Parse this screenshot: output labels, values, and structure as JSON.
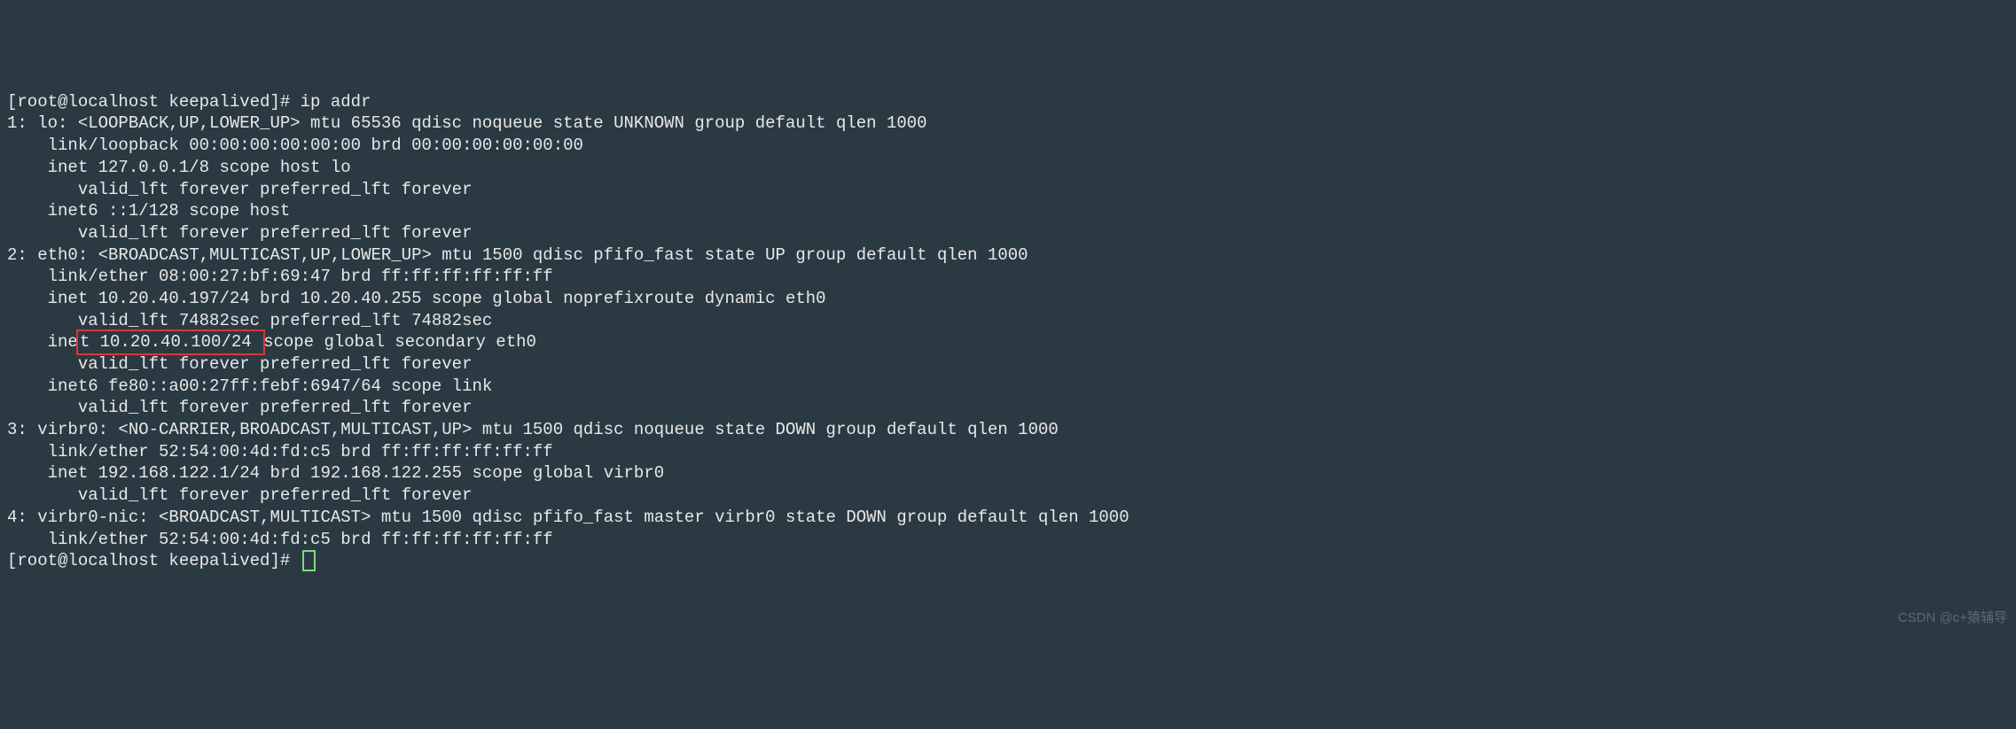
{
  "prompt1": "[root@localhost keepalived]# ",
  "cmd1": "ip addr",
  "lines": {
    "l01": "1: lo: <LOOPBACK,UP,LOWER_UP> mtu 65536 qdisc noqueue state UNKNOWN group default qlen 1000",
    "l02": "    link/loopback 00:00:00:00:00:00 brd 00:00:00:00:00:00",
    "l03": "    inet 127.0.0.1/8 scope host lo",
    "l04": "       valid_lft forever preferred_lft forever",
    "l05": "    inet6 ::1/128 scope host",
    "l06": "       valid_lft forever preferred_lft forever",
    "l07": "2: eth0: <BROADCAST,MULTICAST,UP,LOWER_UP> mtu 1500 qdisc pfifo_fast state UP group default qlen 1000",
    "l08": "    link/ether 08:00:27:bf:69:47 brd ff:ff:ff:ff:ff:ff",
    "l09": "    inet 10.20.40.197/24 brd 10.20.40.255 scope global noprefixroute dynamic eth0",
    "l10a": "       valid_lft 74882sec",
    "l10b": " preferred_lft 74882sec",
    "l11a": "    ine",
    "l11b": "t 10.20.40.100/24 ",
    "l11c": "scope global secondary eth0",
    "l12": "       valid_lft forever preferred_lft forever",
    "l13": "    inet6 fe80::a00:27ff:febf:6947/64 scope link",
    "l14": "       valid_lft forever preferred_lft forever",
    "l15": "3: virbr0: <NO-CARRIER,BROADCAST,MULTICAST,UP> mtu 1500 qdisc noqueue state DOWN group default qlen 1000",
    "l16": "    link/ether 52:54:00:4d:fd:c5 brd ff:ff:ff:ff:ff:ff",
    "l17": "    inet 192.168.122.1/24 brd 192.168.122.255 scope global virbr0",
    "l18": "       valid_lft forever preferred_lft forever",
    "l19": "4: virbr0-nic: <BROADCAST,MULTICAST> mtu 1500 qdisc pfifo_fast master virbr0 state DOWN group default qlen 1000",
    "l20": "    link/ether 52:54:00:4d:fd:c5 brd ff:ff:ff:ff:ff:ff"
  },
  "prompt2": "[root@localhost keepalived]# ",
  "watermark": "CSDN @c+猿辅导"
}
